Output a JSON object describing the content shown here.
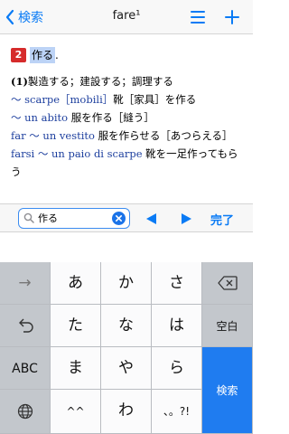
{
  "nav": {
    "back_label": "検索",
    "title": "fare¹",
    "menu_icon": "hamburger-menu-icon",
    "add_icon": "plus-icon"
  },
  "entry": {
    "sense_number": "2",
    "sense_word": "作る",
    "sense_dot": ".",
    "lines": [
      [
        {
          "t": "(1)",
          "s": "b"
        },
        {
          "t": "製造する；建設する；調理する",
          "s": ""
        }
      ],
      [
        {
          "t": "〜 scarpe［mobili］",
          "s": "it"
        },
        {
          "t": "靴［家具］を作る",
          "s": ""
        }
      ],
      [
        {
          "t": "〜 un abito ",
          "s": "it"
        },
        {
          "t": "服を作る［縫う］",
          "s": ""
        }
      ],
      [
        {
          "t": "far 〜 un vestito ",
          "s": "it"
        },
        {
          "t": "服を作らせる［あつらえる］",
          "s": ""
        }
      ],
      [
        {
          "t": "farsi 〜 un paio di scarpe ",
          "s": "it"
        },
        {
          "t": "靴を一足作ってもらう",
          "s": ""
        }
      ]
    ]
  },
  "search": {
    "value": "作る",
    "placeholder": "",
    "done_label": "完了"
  },
  "keyboard": {
    "rows": [
      [
        "→",
        "あ",
        "か",
        "さ",
        "⌫"
      ],
      [
        "↺",
        "た",
        "な",
        "は",
        "空白"
      ],
      [
        "ABC",
        "ま",
        "や",
        "ら",
        "検索"
      ],
      [
        "🌐",
        "^^",
        "わ",
        "、。?!",
        ""
      ]
    ]
  },
  "colors": {
    "accent": "#0a7bf5",
    "sense_badge": "#d62b2b",
    "highlight": "#bcd3f6",
    "italian_text": "#1d3f9e",
    "search_key": "#1f7cf0"
  }
}
